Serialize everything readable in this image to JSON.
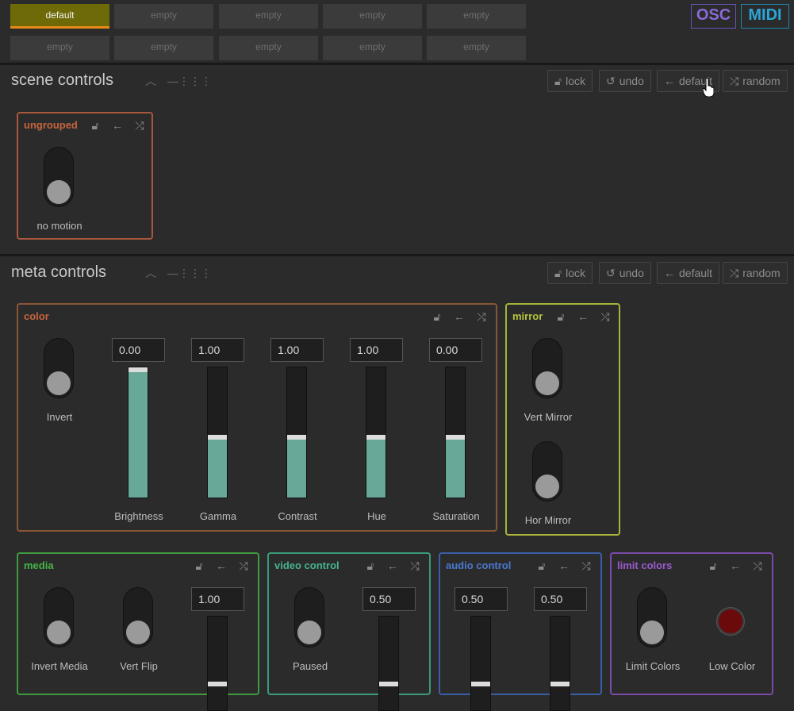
{
  "presets": {
    "slots": [
      "default",
      "empty",
      "empty",
      "empty",
      "empty",
      "empty",
      "empty",
      "empty",
      "empty",
      "empty"
    ]
  },
  "protocol": {
    "osc": "OSC",
    "midi": "MIDI"
  },
  "scene": {
    "title": "scene controls",
    "buttons": {
      "lock": "lock",
      "undo": "undo",
      "default": "default",
      "random": "random"
    },
    "groups": {
      "ungrouped": {
        "title": "ungrouped",
        "toggle_label": "no motion"
      }
    }
  },
  "meta": {
    "title": "meta controls",
    "buttons": {
      "lock": "lock",
      "undo": "undo",
      "default": "default",
      "random": "random"
    },
    "groups": {
      "color": {
        "title": "color",
        "invert_label": "Invert",
        "sliders": [
          {
            "label": "Brightness",
            "value": "0.00",
            "level": 1.0
          },
          {
            "label": "Gamma",
            "value": "1.00",
            "level": 0.48
          },
          {
            "label": "Contrast",
            "value": "1.00",
            "level": 0.48
          },
          {
            "label": "Hue",
            "value": "1.00",
            "level": 0.48
          },
          {
            "label": "Saturation",
            "value": "0.00",
            "level": 0.48
          }
        ]
      },
      "mirror": {
        "title": "mirror",
        "vert_label": "Vert Mirror",
        "hor_label": "Hor Mirror"
      },
      "media": {
        "title": "media",
        "invert_label": "Invert Media",
        "flip_label": "Vert Flip",
        "slider_value": "1.00"
      },
      "video": {
        "title": "video control",
        "paused_label": "Paused",
        "slider_value": "0.50"
      },
      "audio": {
        "title": "audio control",
        "value1": "0.50",
        "value2": "0.50"
      },
      "limit": {
        "title": "limit colors",
        "toggle_label": "Limit Colors",
        "color_label": "Low Color"
      }
    }
  },
  "colors": {
    "ungrouped": "#a9573a",
    "color": "#8a5535",
    "mirror": "#a8b438",
    "media": "#3e9a3e",
    "video": "#3a9a7a",
    "audio": "#3a5ea8",
    "limit": "#7a4aa8",
    "slider_fill": "#68a899"
  },
  "icons": {
    "lock": "lock-icon",
    "undo": "undo-icon",
    "default": "arrow-left-icon",
    "random": "shuffle-icon",
    "collapse": "chevron-up-icon",
    "minimize": "minus-icon",
    "grid": "grid-icon"
  }
}
